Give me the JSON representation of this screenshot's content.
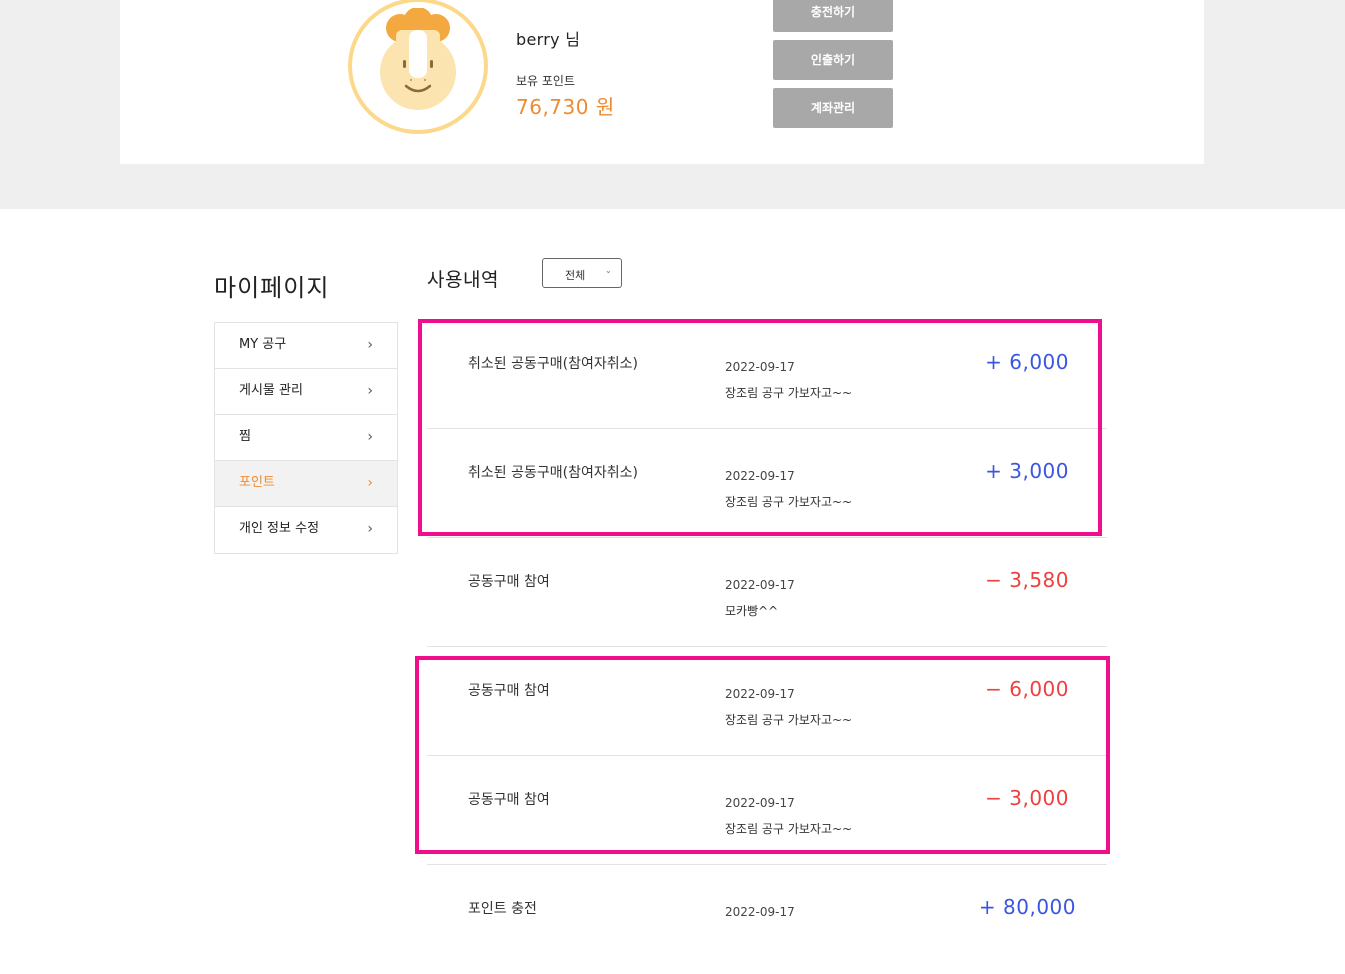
{
  "profile": {
    "username": "berry 님",
    "points_label": "보유 포인트",
    "points_value": "76,730 원",
    "buttons": [
      "충전하기",
      "인출하기",
      "계좌관리"
    ]
  },
  "sidebar": {
    "title": "마이페이지",
    "items": [
      {
        "label": "MY 공구",
        "active": false
      },
      {
        "label": "게시물 관리",
        "active": false
      },
      {
        "label": "찜",
        "active": false
      },
      {
        "label": "포인트",
        "active": true
      },
      {
        "label": "개인 정보 수정",
        "active": false
      }
    ]
  },
  "history": {
    "title": "사용내역",
    "filter_value": "전체",
    "rows": [
      {
        "title": "취소된 공동구매(참여자취소)",
        "date": "2022-09-17",
        "memo": "장조림 공구 가보자고~~",
        "amount": "+ 6,000",
        "type": "plus"
      },
      {
        "title": "취소된 공동구매(참여자취소)",
        "date": "2022-09-17",
        "memo": "장조림 공구 가보자고~~",
        "amount": "+ 3,000",
        "type": "plus"
      },
      {
        "title": "공동구매 참여",
        "date": "2022-09-17",
        "memo": "모카빵^^",
        "amount": "− 3,580",
        "type": "minus"
      },
      {
        "title": "공동구매 참여",
        "date": "2022-09-17",
        "memo": "장조림 공구 가보자고~~",
        "amount": "− 6,000",
        "type": "minus"
      },
      {
        "title": "공동구매 참여",
        "date": "2022-09-17",
        "memo": "장조림 공구 가보자고~~",
        "amount": "− 3,000",
        "type": "minus"
      },
      {
        "title": "포인트 충전",
        "date": "2022-09-17",
        "memo": "",
        "amount": "+ 80,000",
        "type": "plus"
      }
    ]
  },
  "colors": {
    "accent": "#f08a30",
    "plus": "#3b56e0",
    "minus": "#ee4040",
    "highlight": "#ef0f8c",
    "button_gray": "#a8a8a8"
  },
  "icons": [
    "lion-avatar-icon",
    "chevron-right-icon",
    "chevron-down-icon"
  ]
}
